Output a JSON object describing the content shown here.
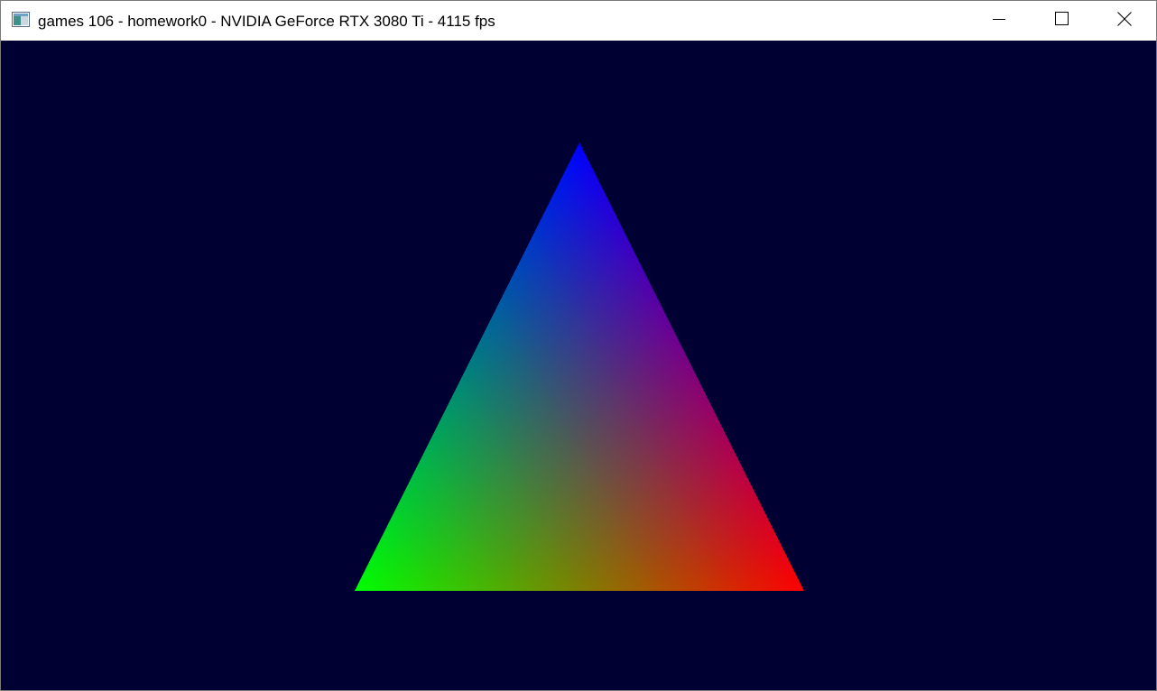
{
  "window": {
    "title": "games 106 - homework0 - NVIDIA GeForce RTX 3080 Ti - 4115 fps",
    "icon": "app-window-icon",
    "controls": {
      "minimize_icon": "minimize-icon",
      "maximize_icon": "maximize-icon",
      "close_icon": "close-icon"
    }
  },
  "scene": {
    "clear_color": "#000033",
    "triangle": {
      "top_vertex_color": "#0000ff",
      "bottom_left_vertex_color": "#00ff00",
      "bottom_right_vertex_color": "#ff0000"
    }
  }
}
